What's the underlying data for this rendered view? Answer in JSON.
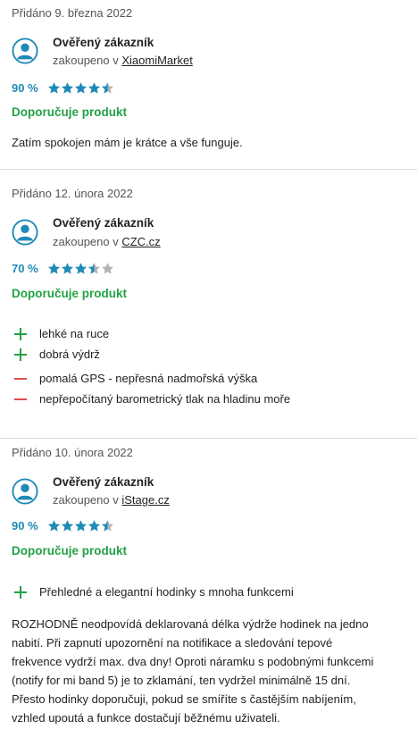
{
  "reviews": [
    {
      "date": "Přidáno 9. března 2022",
      "author": "Ověřený zákazník",
      "bought_prefix": "zakoupeno v ",
      "shop": "XiaomiMarket",
      "percent": "90 %",
      "stars": 4.5,
      "recommend": "Doporučuje produkt",
      "text": "Zatím spokojen mám je krátce a vše funguje."
    },
    {
      "date": "Přidáno 12. února 2022",
      "author": "Ověřený zákazník",
      "bought_prefix": "zakoupeno v ",
      "shop": "CZC.cz",
      "percent": "70 %",
      "stars": 3.5,
      "recommend": "Doporučuje produkt",
      "pros": [
        "lehké na ruce",
        "dobrá výdrž"
      ],
      "cons": [
        "pomalá GPS - nepřesná nadmořská výška",
        "nepřepočítaný barometrický tlak na hladinu moře"
      ]
    },
    {
      "date": "Přidáno 10. února 2022",
      "author": "Ověřený zákazník",
      "bought_prefix": "zakoupeno v ",
      "shop": "iStage.cz",
      "percent": "90 %",
      "stars": 4.5,
      "recommend": "Doporučuje produkt",
      "pros": [
        "Přehledné a elegantní hodinky s mnoha funkcemi"
      ],
      "text_lines": [
        "ROZHODNĚ neodpovídá deklarovaná délka výdrže hodinek na jedno",
        "nabití. Při zapnutí upozornění na notifikace a sledování tepové",
        "frekvence vydrží max. dva dny! Oproti náramku s podobnými funkcemi",
        "(notify for mi band 5) je to zklamání, ten vydržel minimálně 15 dní.",
        "Přesto hodinky doporučuji, pokud se smíříte s častějším nabíjením,",
        "vzhled upoutá a funkce dostačují běžnému uživateli."
      ]
    }
  ],
  "colors": {
    "accent": "#1e8ab7",
    "star": "#1e8ab7",
    "star_empty": "#b3b3b3",
    "recommend": "#22a244",
    "pro": "#22a244",
    "con": "#e04b4b"
  },
  "icons": {
    "avatar": "user-avatar-icon",
    "star": "star-icon",
    "pro": "plus-icon",
    "con": "minus-icon"
  }
}
